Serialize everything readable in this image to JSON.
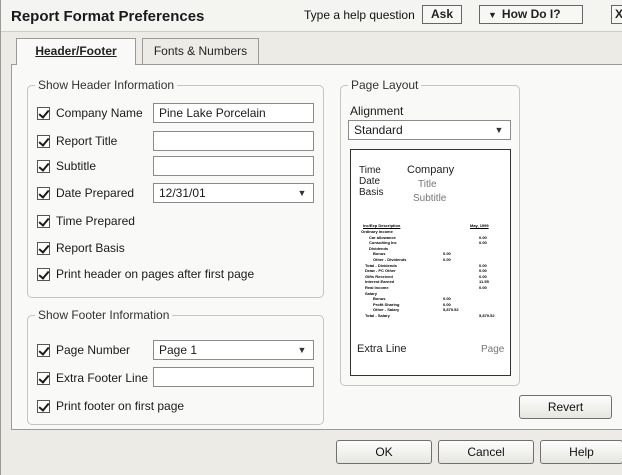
{
  "window": {
    "title": "Report Format Preferences",
    "help_prompt": "Type a help question",
    "ask_label": "Ask",
    "how_do_i_label": "How Do I?",
    "close_label": "X"
  },
  "tabs": [
    {
      "label": "Header/Footer",
      "active": true
    },
    {
      "label": "Fonts & Numbers",
      "active": false
    }
  ],
  "header_section": {
    "title": "Show Header Information",
    "items": [
      {
        "label": "Company Name",
        "checked": true,
        "value": "Pine Lake Porcelain"
      },
      {
        "label": "Report Title",
        "checked": true,
        "value": ""
      },
      {
        "label": "Subtitle",
        "checked": true,
        "value": ""
      },
      {
        "label": "Date Prepared",
        "checked": true,
        "value": "12/31/01"
      },
      {
        "label": "Time Prepared",
        "checked": true
      },
      {
        "label": "Report Basis",
        "checked": true
      },
      {
        "label": "Print header on pages after first page",
        "checked": true
      }
    ]
  },
  "footer_section": {
    "title": "Show Footer Information",
    "items": [
      {
        "label": "Page Number",
        "checked": true,
        "value": "Page 1"
      },
      {
        "label": "Extra Footer Line",
        "checked": true,
        "value": ""
      },
      {
        "label": "Print footer on first page",
        "checked": true
      }
    ]
  },
  "page_layout": {
    "title": "Page Layout",
    "alignment_label": "Alignment",
    "alignment_value": "Standard",
    "preview": {
      "time": "Time",
      "date": "Date",
      "basis": "Basis",
      "company": "Company",
      "title": "Title",
      "subtitle": "Subtitle",
      "extra_line": "Extra Line",
      "page": "Page",
      "col_header_left": "Inc/Exp Description",
      "col_header_right": "May, 1999",
      "rows": [
        {
          "label": "Ordinary Income",
          "indent": 0,
          "value": ""
        },
        {
          "label": "Car allowance",
          "indent": 2,
          "value": "0.00"
        },
        {
          "label": "Consulting Inc",
          "indent": 2,
          "value": "0.00"
        },
        {
          "label": "Dividends",
          "indent": 2,
          "value": ""
        },
        {
          "label": "Bonus",
          "indent": 3,
          "value": "",
          "mid": "0.00"
        },
        {
          "label": "Other - Dividends",
          "indent": 3,
          "value": "",
          "mid": "0.00"
        },
        {
          "label": "Total - Dividends",
          "indent": 1,
          "value": "0.00"
        },
        {
          "label": "Draw - PC Other",
          "indent": 1,
          "value": "0.00"
        },
        {
          "label": "Gifts Received",
          "indent": 1,
          "value": "0.00"
        },
        {
          "label": "Interest Earned",
          "indent": 1,
          "value": "11.55"
        },
        {
          "label": "Real Income",
          "indent": 1,
          "value": "0.00"
        },
        {
          "label": "Salary",
          "indent": 1,
          "value": ""
        },
        {
          "label": "Bonus",
          "indent": 3,
          "value": "",
          "mid": "0.00"
        },
        {
          "label": "Profit Sharing",
          "indent": 3,
          "value": "",
          "mid": "0.00"
        },
        {
          "label": "Other - Salary",
          "indent": 3,
          "value": "",
          "mid": "5,879.52"
        },
        {
          "label": "Total - Salary",
          "indent": 1,
          "value": "5,879.52"
        }
      ]
    }
  },
  "buttons": {
    "revert": "Revert",
    "ok": "OK",
    "cancel": "Cancel",
    "help": "Help"
  }
}
